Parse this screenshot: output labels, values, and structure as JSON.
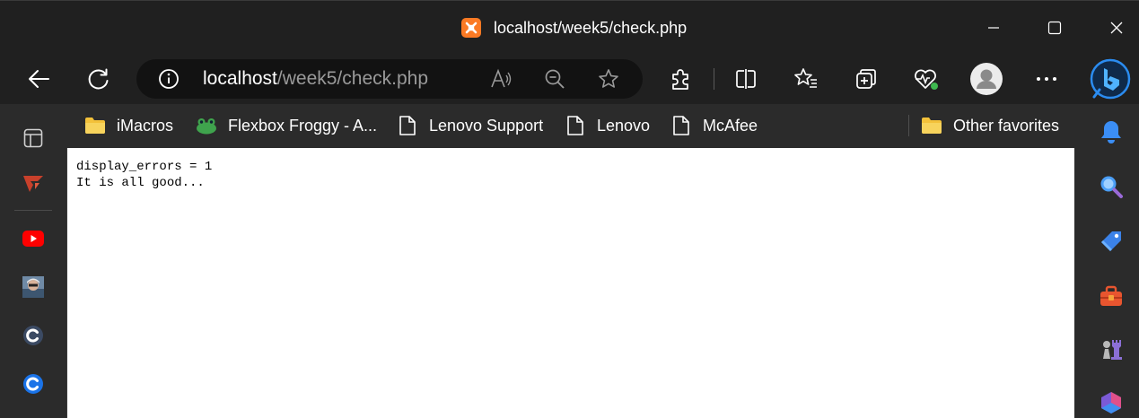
{
  "window": {
    "title": "localhost/week5/check.php",
    "favicon": "xampp-icon"
  },
  "address_bar": {
    "host": "localhost",
    "path": "/week5/check.php"
  },
  "favorites": [
    {
      "label": "iMacros",
      "icon": "folder-icon"
    },
    {
      "label": "Flexbox Froggy - A...",
      "icon": "frog-icon"
    },
    {
      "label": "Lenovo Support",
      "icon": "page-icon"
    },
    {
      "label": "Lenovo",
      "icon": "page-icon"
    },
    {
      "label": "McAfee",
      "icon": "page-icon"
    }
  ],
  "other_favorites": {
    "label": "Other favorites",
    "icon": "folder-icon"
  },
  "page": {
    "lines": [
      "display_errors = 1",
      "It is all good..."
    ]
  },
  "colors": {
    "chrome_bg": "#202020",
    "bar_bg": "#2b2b2b",
    "address_bg": "#121212",
    "xampp_orange": "#fb7a24",
    "folder_yellow": "#f3c13a",
    "page_bg": "#ffffff"
  }
}
